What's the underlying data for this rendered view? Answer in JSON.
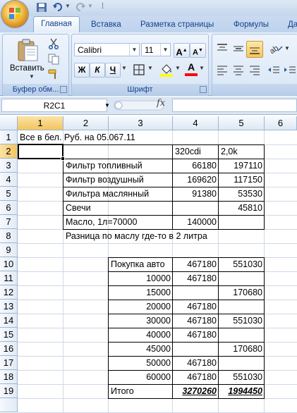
{
  "title_bar": {
    "quick_access_separator": "⁞"
  },
  "tabs": [
    "Главная",
    "Вставка",
    "Разметка страницы",
    "Формулы",
    "Да"
  ],
  "ribbon": {
    "clipboard": {
      "paste_label": "Вставить",
      "group_label": "Буфер обм..."
    },
    "font": {
      "font_name": "Calibri",
      "font_size": "11",
      "grow_label": "A",
      "shrink_label": "A",
      "bold_label": "Ж",
      "italic_label": "К",
      "underline_label": "Ч",
      "font_color_label": "A",
      "group_label": "Шрифт"
    }
  },
  "formula_bar": {
    "name_box": "R2C1",
    "fx": "fx",
    "value": ""
  },
  "columns": [
    "1",
    "2",
    "3",
    "4",
    "5",
    "6"
  ],
  "rows": [
    "1",
    "2",
    "3",
    "4",
    "5",
    "6",
    "7",
    "8",
    "9",
    "10",
    "11",
    "12",
    "13",
    "14",
    "15",
    "16",
    "17",
    "18",
    "19"
  ],
  "selected_cell": "R2C1",
  "cells": {
    "r1": "Все в бел. Руб. на 05.067.11",
    "r2": {
      "c4": "320cdi",
      "c5": "2,0k"
    },
    "r3": {
      "c3": "Фильтр топливный",
      "c4": "66180",
      "c5": "197110"
    },
    "r4": {
      "c3": "Фильтр воздушный",
      "c4": "169620",
      "c5": "117150"
    },
    "r5": {
      "c3": "Фильтра маслянный",
      "c4": "91380",
      "c5": "53530"
    },
    "r6": {
      "c3": "Свечи",
      "c4": "",
      "c5": "45810"
    },
    "r7": {
      "c3": "Масло, 1л=70000",
      "c4": "140000",
      "c5": ""
    },
    "r8": "Разница по маслу где-то в 2 литра",
    "r10": {
      "c3": "Покупка авто",
      "c4": "467180",
      "c5": "551030"
    },
    "r11": {
      "c3": "10000",
      "c4": "467180",
      "c5": ""
    },
    "r12": {
      "c3": "15000",
      "c4": "",
      "c5": "170680"
    },
    "r13": {
      "c3": "20000",
      "c4": "467180",
      "c5": ""
    },
    "r14": {
      "c3": "30000",
      "c4": "467180",
      "c5": "551030"
    },
    "r15": {
      "c3": "40000",
      "c4": "467180",
      "c5": ""
    },
    "r16": {
      "c3": "45000",
      "c4": "",
      "c5": "170680"
    },
    "r17": {
      "c3": "50000",
      "c4": "467180",
      "c5": ""
    },
    "r18": {
      "c3": "60000",
      "c4": "467180",
      "c5": "551030"
    },
    "r19": {
      "c3": "Итого",
      "c4": "3270260",
      "c5": "1994450"
    }
  }
}
